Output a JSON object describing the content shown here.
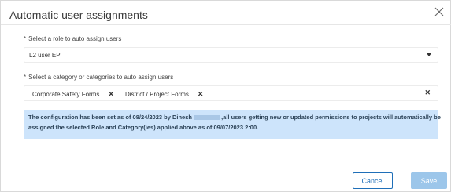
{
  "dialog": {
    "title": "Automatic user assignments",
    "close_icon": "close-icon"
  },
  "role": {
    "required_mark": "*",
    "label": "Select a role to auto assign users",
    "selected_value": "L2 user EP",
    "dropdown_icon": "caret-down-icon"
  },
  "category": {
    "required_mark": "*",
    "label": "Select a category or categories to auto assign users",
    "chips": [
      {
        "label": "Corporate Safety Forms",
        "remove": "✕"
      },
      {
        "label": "District / Project Forms",
        "remove": "✕"
      }
    ],
    "clear": "✕"
  },
  "info": {
    "line1_prefix": "The configuration has been set as of 08/24/2023 by Dinesh",
    "line1_suffix": ",all users getting new or updated permissions to projects will automatically be",
    "line2": "assigned the selected Role and Category(ies) applied above as of 09/07/2023 2:00."
  },
  "buttons": {
    "cancel": "Cancel",
    "save": "Save"
  },
  "colors": {
    "info_bg": "#cde4fb",
    "primary": "#1f6fb8",
    "save_disabled": "#9cc6ea"
  }
}
